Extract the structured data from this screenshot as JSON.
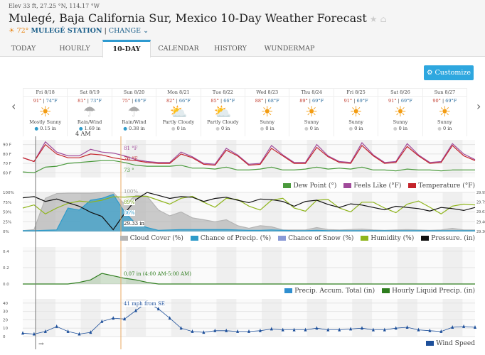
{
  "header": {
    "elevation": "Elev 33 ft, 27.25 °N, 114.17 °W",
    "title": "Mulegé, Baja California Sur, Mexico 10-Day Weather Forecast",
    "current_temp": "72°",
    "station": "MULEGÉ STATION",
    "separator": "|",
    "change": "CHANGE"
  },
  "tabs": [
    {
      "label": "TODAY"
    },
    {
      "label": "HOURLY"
    },
    {
      "label": "10-DAY",
      "active": true
    },
    {
      "label": "CALENDAR"
    },
    {
      "label": "HISTORY"
    },
    {
      "label": "WUNDERMAP"
    }
  ],
  "customize_label": "Customize",
  "days": [
    {
      "name": "Fri 8/18",
      "hi": "91°",
      "lo": "74°F",
      "icon": "mostly-sunny",
      "cond": "Mostly Sunny",
      "precip": "0.15 in"
    },
    {
      "name": "Sat 8/19",
      "hi": "81°",
      "lo": "73°F",
      "icon": "rain",
      "cond": "Rain/Wind",
      "precip": "1.69 in"
    },
    {
      "name": "Sun 8/20",
      "hi": "75°",
      "lo": "69°F",
      "icon": "rain",
      "cond": "Rain/Wind",
      "precip": "0.38 in"
    },
    {
      "name": "Mon 8/21",
      "hi": "82°",
      "lo": "66°F",
      "icon": "partly-cloudy",
      "cond": "Partly Cloudy",
      "precip": "0 in"
    },
    {
      "name": "Tue 8/22",
      "hi": "85°",
      "lo": "66°F",
      "icon": "partly-cloudy",
      "cond": "Partly Cloudy",
      "precip": "0 in"
    },
    {
      "name": "Wed 8/23",
      "hi": "88°",
      "lo": "68°F",
      "icon": "sunny",
      "cond": "Sunny",
      "precip": "0 in"
    },
    {
      "name": "Thu 8/24",
      "hi": "89°",
      "lo": "69°F",
      "icon": "sunny",
      "cond": "Sunny",
      "precip": "0 in"
    },
    {
      "name": "Fri 8/25",
      "hi": "91°",
      "lo": "69°F",
      "icon": "sunny",
      "cond": "Sunny",
      "precip": "0 in"
    },
    {
      "name": "Sat 8/26",
      "hi": "91°",
      "lo": "69°F",
      "icon": "sunny",
      "cond": "Sunny",
      "precip": "0 in"
    },
    {
      "name": "Sun 8/27",
      "hi": "90°",
      "lo": "69°F",
      "icon": "sunny",
      "cond": "Sunny",
      "precip": "0 in"
    }
  ],
  "cursor_time": "4 AM",
  "annotations": {
    "feels": "81 °F",
    "temp": "76 °F",
    "dew": "73 °",
    "cloud": "100%",
    "humidity": "89%",
    "precip_chance": "86%",
    "pressure": "29.33 in",
    "hourly_precip": "0.07 in (4:00 AM-5:00 AM)",
    "wind": "41 mph from SE"
  },
  "chart_data": [
    {
      "type": "line",
      "yticks": [
        "90 F",
        "80 F",
        "70 F",
        "60 F"
      ],
      "ylim": [
        55,
        95
      ],
      "series": [
        {
          "name": "Dew Point (°)",
          "color": "#4a9a3c",
          "values": [
            61,
            60,
            66,
            67,
            70,
            71,
            72,
            73,
            73,
            71,
            68,
            67,
            67,
            67,
            68,
            65,
            65,
            64,
            66,
            63,
            63,
            64,
            66,
            63,
            63,
            64,
            66,
            64,
            65,
            64,
            66,
            63,
            63,
            62,
            64,
            63,
            63,
            62,
            63,
            63,
            63
          ]
        },
        {
          "name": "Feels Like (°F)",
          "color": "#a04a9a",
          "values": [
            76,
            72,
            93,
            82,
            78,
            78,
            85,
            82,
            81,
            78,
            74,
            72,
            71,
            71,
            82,
            77,
            70,
            69,
            86,
            79,
            69,
            70,
            89,
            79,
            71,
            71,
            90,
            78,
            72,
            71,
            92,
            79,
            71,
            72,
            91,
            79,
            71,
            72,
            91,
            80,
            74
          ]
        },
        {
          "name": "Temperature (°F)",
          "color": "#c4242b",
          "values": [
            76,
            72,
            90,
            80,
            76,
            76,
            80,
            79,
            76,
            74,
            73,
            71,
            70,
            70,
            80,
            76,
            69,
            68,
            84,
            78,
            68,
            69,
            86,
            78,
            70,
            70,
            87,
            77,
            71,
            70,
            89,
            78,
            70,
            71,
            88,
            78,
            70,
            71,
            89,
            78,
            73
          ]
        }
      ]
    },
    {
      "type": "area",
      "yticks": [
        "100%",
        "75%",
        "50%",
        "25%",
        "0%"
      ],
      "ylim": [
        0,
        100
      ],
      "y2ticks": [
        "29.95",
        "29.79",
        "29.63",
        "29.46",
        "29.30"
      ],
      "y2lim": [
        29.3,
        29.95
      ],
      "series": [
        {
          "name": "Cloud Cover (%)",
          "color": "#b5b5b5",
          "values": [
            2,
            5,
            85,
            97,
            98,
            98,
            98,
            100,
            100,
            70,
            92,
            90,
            55,
            40,
            50,
            35,
            30,
            25,
            30,
            15,
            8,
            15,
            12,
            4,
            4,
            4,
            10,
            5,
            4,
            5,
            6,
            4,
            3,
            4,
            5,
            4,
            3,
            4,
            8,
            4,
            4
          ]
        },
        {
          "name": "Chance of Precip. (%)",
          "color": "#2f9bc9",
          "values": [
            2,
            2,
            3,
            4,
            60,
            55,
            80,
            85,
            95,
            50,
            20,
            10,
            3,
            4,
            5,
            5,
            5,
            5,
            5,
            4,
            3,
            3,
            4,
            3,
            2,
            2,
            3,
            2,
            2,
            2,
            2,
            2,
            2,
            2,
            2,
            2,
            2,
            2,
            2,
            2,
            2
          ]
        },
        {
          "name": "Chance of Snow (%)",
          "color": "#8a9ad6",
          "values": []
        },
        {
          "name": "Humidity (%)",
          "color": "#8fb51c",
          "values": [
            60,
            68,
            45,
            60,
            72,
            78,
            75,
            80,
            89,
            88,
            90,
            90,
            80,
            70,
            85,
            90,
            75,
            62,
            85,
            82,
            65,
            55,
            80,
            85,
            60,
            52,
            80,
            82,
            60,
            50,
            75,
            75,
            60,
            48,
            70,
            78,
            62,
            45,
            65,
            70,
            68
          ]
        },
        {
          "name": "Pressure. (in)",
          "color": "#111111",
          "values": [
            29.86,
            29.88,
            29.8,
            29.84,
            29.78,
            29.72,
            29.62,
            29.55,
            29.33,
            29.6,
            29.83,
            29.95,
            29.9,
            29.85,
            29.88,
            29.87,
            29.8,
            29.85,
            29.87,
            29.82,
            29.78,
            29.84,
            29.83,
            29.8,
            29.72,
            29.8,
            29.82,
            29.75,
            29.7,
            29.76,
            29.74,
            29.7,
            29.66,
            29.72,
            29.7,
            29.68,
            29.64,
            29.7,
            29.68,
            29.65,
            29.7
          ]
        }
      ]
    },
    {
      "type": "area",
      "yticks": [
        "0.4",
        "0.2",
        "0.0"
      ],
      "ylim": [
        0,
        0.45
      ],
      "series": [
        {
          "name": "Precip. Accum. Total (in)",
          "color": "#2f8fd0",
          "values": []
        },
        {
          "name": "Hourly Liquid Precip. (in)",
          "color": "#2e7d1e",
          "values": [
            0,
            0,
            0,
            0,
            0,
            0.02,
            0.05,
            0.13,
            0.1,
            0.07,
            0.05,
            0.02,
            0,
            0,
            0,
            0,
            0,
            0,
            0,
            0,
            0,
            0,
            0,
            0,
            0,
            0,
            0,
            0,
            0,
            0,
            0,
            0,
            0,
            0,
            0,
            0,
            0,
            0,
            0,
            0,
            0
          ]
        }
      ]
    },
    {
      "type": "line",
      "yticks": [
        "40",
        "30",
        "20",
        "10",
        "0"
      ],
      "ylim": [
        0,
        45
      ],
      "series": [
        {
          "name": "Wind Speed",
          "color": "#1d4f9a",
          "values": [
            4,
            3,
            6,
            12,
            6,
            3,
            5,
            18,
            22,
            21,
            31,
            41,
            33,
            22,
            10,
            6,
            5,
            7,
            7,
            6,
            6,
            7,
            9,
            8,
            8,
            8,
            10,
            8,
            8,
            9,
            10,
            8,
            8,
            10,
            11,
            8,
            7,
            6,
            11,
            12,
            11
          ]
        }
      ]
    }
  ]
}
